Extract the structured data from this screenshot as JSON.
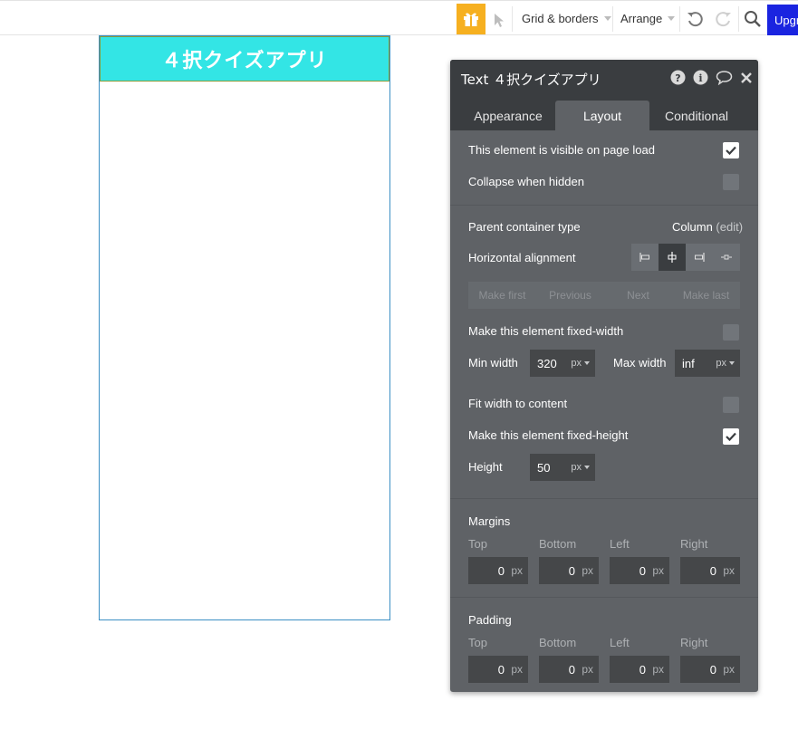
{
  "toolbar": {
    "grid_borders_label": "Grid & borders",
    "arrange_label": "Arrange",
    "upgrade_label": "Upgr",
    "gift_color": "#f6b020",
    "upgrade_color": "#1a24e0"
  },
  "canvas": {
    "header_text": "４択クイズアプリ",
    "header_color": "#33e5e5"
  },
  "editor": {
    "title": "Text ４択クイズアプリ",
    "icons": [
      "help-icon",
      "info-icon",
      "comment-icon",
      "close-icon"
    ],
    "tabs": [
      {
        "label": "Appearance",
        "active": false
      },
      {
        "label": "Layout",
        "active": true
      },
      {
        "label": "Conditional",
        "active": false
      }
    ],
    "visible_on_load": {
      "label": "This element is visible on page load",
      "checked": true
    },
    "collapse_when_hidden": {
      "label": "Collapse when hidden",
      "checked": false
    },
    "parent_container": {
      "label": "Parent container type",
      "value": "Column",
      "edit": "(edit)"
    },
    "horizontal_alignment": {
      "label": "Horizontal alignment",
      "selected": "center"
    },
    "order_buttons": [
      "Make first",
      "Previous",
      "Next",
      "Make last"
    ],
    "fixed_width": {
      "label": "Make this element fixed-width",
      "checked": false
    },
    "min_width": {
      "label": "Min width",
      "value": "320",
      "unit": "px"
    },
    "max_width": {
      "label": "Max width",
      "value": "inf",
      "unit": "px"
    },
    "fit_width": {
      "label": "Fit width to content",
      "checked": false
    },
    "fixed_height": {
      "label": "Make this element fixed-height",
      "checked": true
    },
    "height": {
      "label": "Height",
      "value": "50",
      "unit": "px"
    },
    "margins": {
      "label": "Margins",
      "sides": [
        {
          "label": "Top",
          "value": "0",
          "unit": "px"
        },
        {
          "label": "Bottom",
          "value": "0",
          "unit": "px"
        },
        {
          "label": "Left",
          "value": "0",
          "unit": "px"
        },
        {
          "label": "Right",
          "value": "0",
          "unit": "px"
        }
      ]
    },
    "padding": {
      "label": "Padding",
      "sides": [
        {
          "label": "Top",
          "value": "0",
          "unit": "px"
        },
        {
          "label": "Bottom",
          "value": "0",
          "unit": "px"
        },
        {
          "label": "Left",
          "value": "0",
          "unit": "px"
        },
        {
          "label": "Right",
          "value": "0",
          "unit": "px"
        }
      ]
    }
  }
}
